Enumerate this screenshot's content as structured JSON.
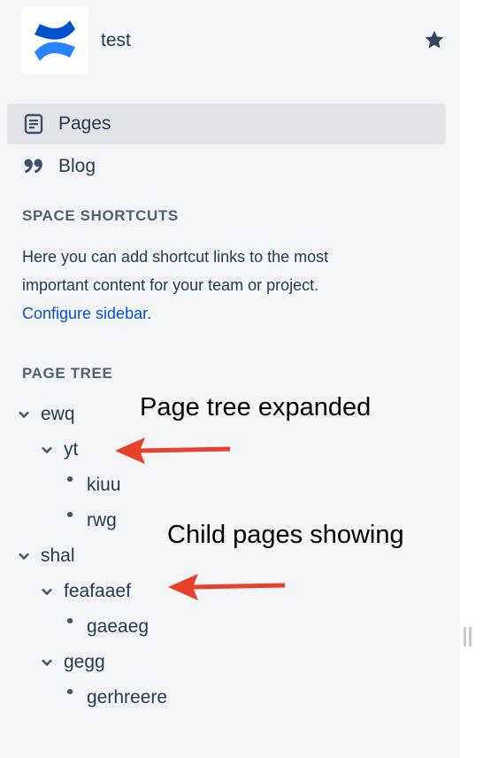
{
  "space": {
    "name": "test",
    "logo_icon": "confluence-logo-icon",
    "star_icon": "star-icon"
  },
  "nav": [
    {
      "label": "Pages",
      "icon": "pages-icon",
      "active": true
    },
    {
      "label": "Blog",
      "icon": "quote-icon",
      "active": false
    }
  ],
  "shortcuts": {
    "heading": "SPACE SHORTCUTS",
    "text_line1": "Here you can add shortcut links to the most",
    "text_line2": "important content for your team or project.",
    "link_label": "Configure sidebar",
    "link_suffix": "."
  },
  "page_tree": {
    "heading": "PAGE TREE",
    "items": [
      {
        "label": "ewq",
        "depth": 0,
        "expanded": true
      },
      {
        "label": "yt",
        "depth": 1,
        "expanded": true
      },
      {
        "label": "kiuu",
        "depth": 2,
        "leaf": true
      },
      {
        "label": "rwg",
        "depth": 2,
        "leaf": true
      },
      {
        "label": "shal",
        "depth": 0,
        "expanded": true
      },
      {
        "label": "feafaaef",
        "depth": 1,
        "expanded": true
      },
      {
        "label": "gaeaeg",
        "depth": 2,
        "leaf": true
      },
      {
        "label": "gegg",
        "depth": 1,
        "expanded": true
      },
      {
        "label": "gerhreere",
        "depth": 2,
        "leaf": true
      }
    ]
  },
  "annotations": {
    "note1": "Page tree expanded",
    "note2": "Child pages showing",
    "arrow_color": "#e8412b"
  },
  "colors": {
    "sidebar_bg": "#f4f5f7",
    "active_bg": "#e1e3e7",
    "link": "#0052cc",
    "text": "#253858"
  }
}
